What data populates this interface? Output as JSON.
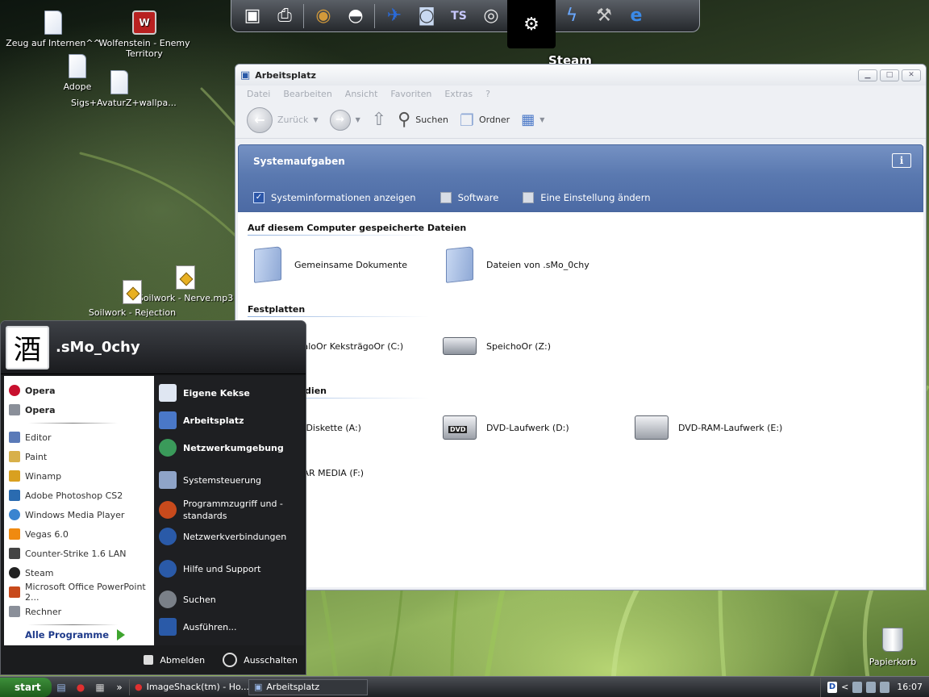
{
  "desktop": {
    "icons": [
      {
        "label": "Zeug auf Internen^^",
        "icon": "folder-doc-icon"
      },
      {
        "label": "Wolfenstein - Enemy Territory",
        "icon": "wolfenstein-icon"
      },
      {
        "label": "Adope",
        "icon": "doc-icon"
      },
      {
        "label": "Sigs+AvaturZ+wallpa...",
        "icon": "doc-icon"
      },
      {
        "label": "Soilwork - Nerve.mp3",
        "icon": "mp3-icon"
      },
      {
        "label": "Soilwork - Rejection",
        "icon": "mp3-icon"
      }
    ],
    "recycle_bin": "Papierkorb"
  },
  "dock": {
    "active_label": "Steam",
    "items": [
      "computer-icon",
      "scanner-icon",
      "eye-icon",
      "helmet-icon",
      "messenger-icon",
      "camera-icon",
      "tvs-icon",
      "cd-icon",
      "steam-icon",
      "lightning-icon",
      "tool-icon",
      "ie-icon"
    ]
  },
  "window": {
    "title": "Arbeitsplatz",
    "buttons": {
      "minimize": "▁",
      "maximize": "□",
      "close": "✕"
    },
    "menu": [
      "Datei",
      "Bearbeiten",
      "Ansicht",
      "Favoriten",
      "Extras",
      "?"
    ],
    "toolbar": {
      "back": "Zurück",
      "search": "Suchen",
      "folders": "Ordner"
    },
    "tasks_header": "Systemaufgaben",
    "tasks_info": "i",
    "tasks": [
      "Systeminformationen anzeigen",
      "Software",
      "Eine Einstellung ändern"
    ],
    "sections": {
      "stored": "Auf diesem Computer gespeicherte Dateien",
      "drives": "Festplatten",
      "removable": "...echselmedien"
    },
    "stored_items": [
      "Gemeinsame Dokumente",
      "Dateien von .sMo_0chy"
    ],
    "drive_items": [
      "...aloOr KeksträgoOr (C:)",
      "SpeichoOr (Z:)"
    ],
    "removable_items": [
      "...-Diskette (A:)",
      "DVD-Laufwerk (D:)",
      "DVD-RAM-Laufwerk (E:)",
      "...AR MEDIA (F:)"
    ],
    "dvd_badge": "DVD"
  },
  "start_menu": {
    "user": ".sMo_0chy",
    "avatar_glyph": "酒",
    "pinned": [
      {
        "label": "Opera",
        "color": "#c8102e"
      },
      {
        "label": "Opera",
        "color": "#8a8f99"
      }
    ],
    "recent": [
      {
        "label": "Editor",
        "color": "#5a7ab8"
      },
      {
        "label": "Paint",
        "color": "#d8b04a"
      },
      {
        "label": "Winamp",
        "color": "#d9a020"
      },
      {
        "label": "Adobe Photoshop CS2",
        "color": "#2a6bb0"
      },
      {
        "label": "Windows Media Player",
        "color": "#3a84d0"
      },
      {
        "label": "Vegas 6.0",
        "color": "#f08a10"
      },
      {
        "label": "Counter-Strike 1.6 LAN",
        "color": "#444444"
      },
      {
        "label": "Steam",
        "color": "#222222"
      },
      {
        "label": "Microsoft Office PowerPoint 2...",
        "color": "#c84a1c"
      },
      {
        "label": "Rechner",
        "color": "#8a8f99"
      }
    ],
    "all_programs": "Alle Programme",
    "places": [
      {
        "label": "Eigene Kekse",
        "bold": true,
        "color": "#dfe6f2"
      },
      {
        "label": "Arbeitsplatz",
        "bold": true,
        "color": "#4a78c8"
      },
      {
        "label": "Netzwerkumgebung",
        "bold": true,
        "color": "#3a9a5a"
      },
      {
        "label": "Systemsteuerung",
        "bold": false,
        "color": "#8fa4c8"
      },
      {
        "label": "Programmzugriff und -standards",
        "bold": false,
        "color": "#c84a1c"
      },
      {
        "label": "Netzwerkverbindungen",
        "bold": false,
        "color": "#2a5aa8"
      },
      {
        "label": "Hilfe und Support",
        "bold": false,
        "color": "#2a5aa8"
      },
      {
        "label": "Suchen",
        "bold": false,
        "color": "#7a8088"
      },
      {
        "label": "Ausführen...",
        "bold": false,
        "color": "#2a5aa8"
      }
    ],
    "logoff": "Abmelden",
    "shutdown": "Ausschalten"
  },
  "taskbar": {
    "start": "start",
    "quicklaunch": [
      "desktop-icon",
      "opera-icon",
      "calculator-icon",
      "more-icon"
    ],
    "more_glyph": "»",
    "tasks": [
      {
        "label": "ImageShack(tm) - Ho...",
        "active": false
      },
      {
        "label": "Arbeitsplatz",
        "active": true
      }
    ],
    "tray_d": "D",
    "tray_arrow": "<",
    "clock": "16:07"
  }
}
